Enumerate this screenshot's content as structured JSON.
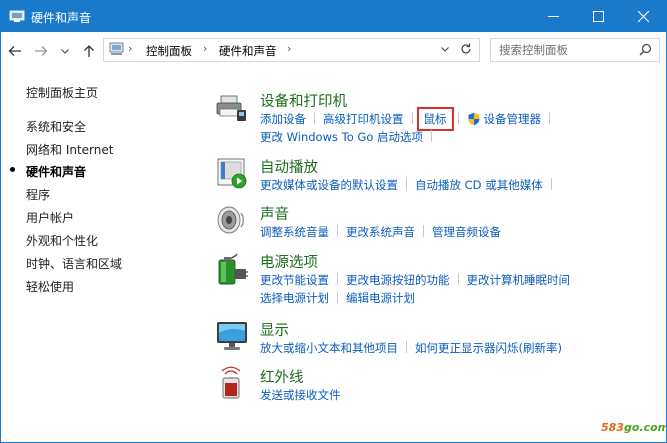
{
  "window": {
    "title": "硬件和声音",
    "accent": "#1979ca"
  },
  "address": {
    "crumbs": [
      "控制面板",
      "硬件和声音"
    ]
  },
  "search": {
    "placeholder": "搜索控制面板"
  },
  "sidebar": {
    "home": "控制面板主页",
    "items": [
      {
        "label": "系统和安全",
        "current": false
      },
      {
        "label": "网络和 Internet",
        "current": false
      },
      {
        "label": "硬件和声音",
        "current": true
      },
      {
        "label": "程序",
        "current": false
      },
      {
        "label": "用户帐户",
        "current": false
      },
      {
        "label": "外观和个性化",
        "current": false
      },
      {
        "label": "时钟、语言和区域",
        "current": false
      },
      {
        "label": "轻松使用",
        "current": false
      }
    ]
  },
  "sections": [
    {
      "title": "设备和打印机",
      "icon": "printer-icon",
      "links": [
        [
          "添加设备",
          "高级打印机设置",
          "鼠标",
          "设备管理器"
        ],
        [
          "更改 Windows To Go 启动选项"
        ]
      ]
    },
    {
      "title": "自动播放",
      "icon": "autoplay-icon",
      "links": [
        [
          "更改媒体或设备的默认设置",
          "自动播放 CD 或其他媒体"
        ]
      ]
    },
    {
      "title": "声音",
      "icon": "speaker-icon",
      "links": [
        [
          "调整系统音量",
          "更改系统声音",
          "管理音频设备"
        ]
      ]
    },
    {
      "title": "电源选项",
      "icon": "battery-icon",
      "links": [
        [
          "更改节能设置",
          "更改电源按钮的功能",
          "更改计算机睡眠时间"
        ],
        [
          "选择电源计划",
          "编辑电源计划"
        ]
      ]
    },
    {
      "title": "显示",
      "icon": "monitor-icon",
      "links": [
        [
          "放大或缩小文本和其他项目",
          "如何更正显示器闪烁(刷新率)"
        ]
      ]
    },
    {
      "title": "红外线",
      "icon": "infrared-icon",
      "links": [
        [
          "发送或接收文件"
        ]
      ]
    }
  ],
  "watermark": {
    "prefix": "583",
    "suffix": "go.com"
  }
}
